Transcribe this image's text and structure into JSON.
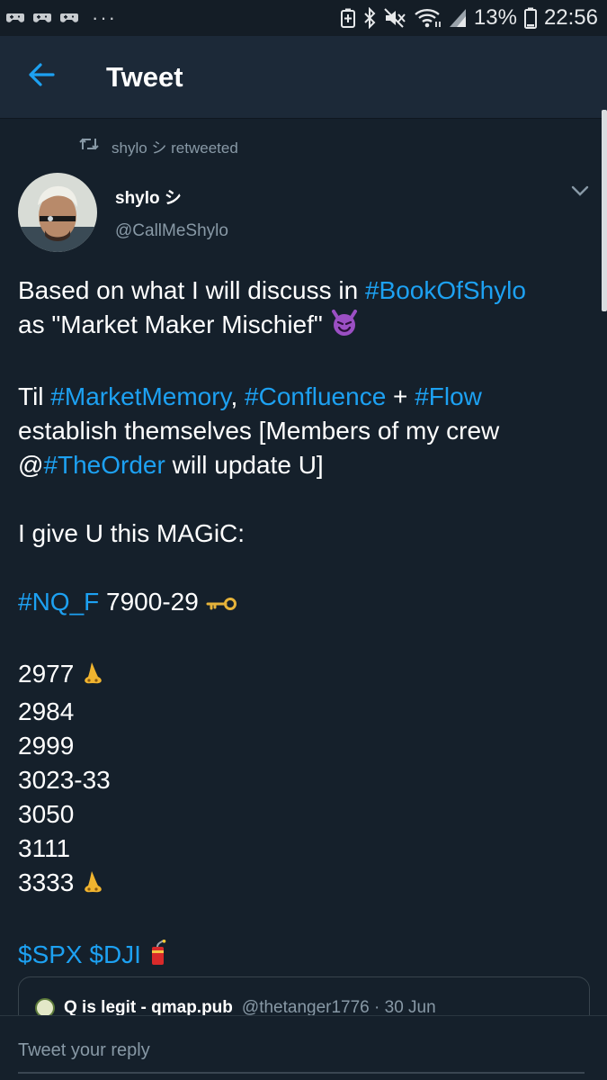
{
  "status_bar": {
    "battery_percent": "13%",
    "time": "22:56",
    "notification_icons": [
      "game-controller-icon",
      "game-controller-icon",
      "game-controller-icon"
    ],
    "more_indicator": "···",
    "system_icons": [
      "battery-saver-icon",
      "bluetooth-icon",
      "mute-icon",
      "wifi-icon",
      "signal-icon",
      "battery-icon"
    ]
  },
  "header": {
    "title": "Tweet"
  },
  "retweet": {
    "text": "shylo シ retweeted"
  },
  "tweet": {
    "author_name": "shylo シ",
    "author_handle": "@CallMeShylo",
    "line1_text": "Based on what I will discuss in ",
    "line1_tag": "#BookOfShylo",
    "line2_text": "as \"Market Maker Mischief\" ",
    "line3_text": "Til ",
    "line3_tag1": "#MarketMemory",
    "line3_sep1": ", ",
    "line3_tag2": "#Confluence",
    "line3_sep2": " + ",
    "line3_tag3": "#Flow",
    "line4_text": "establish themselves [Members of my crew",
    "line5_prefix": "@",
    "line5_tag": "#TheOrder",
    "line5_text": " will update U]",
    "line6_text": "I give U this MAGiC:",
    "line7_tag": "#NQ_F",
    "line7_text": " 7900-29 ",
    "levels": [
      "2977",
      "2984",
      "2999",
      "3023-33",
      "3050",
      "3111",
      "3333"
    ],
    "cashtags": "$SPX $DJI"
  },
  "quoted_tweet": {
    "name": "Q is legit - qmap.pub",
    "handle_date": "@thetanger1776 · 30 Jun"
  },
  "reply": {
    "placeholder": "Tweet your reply"
  },
  "colors": {
    "accent": "#1da1f2",
    "background": "#15202b",
    "header": "#1c2938",
    "muted": "#8899a6"
  }
}
